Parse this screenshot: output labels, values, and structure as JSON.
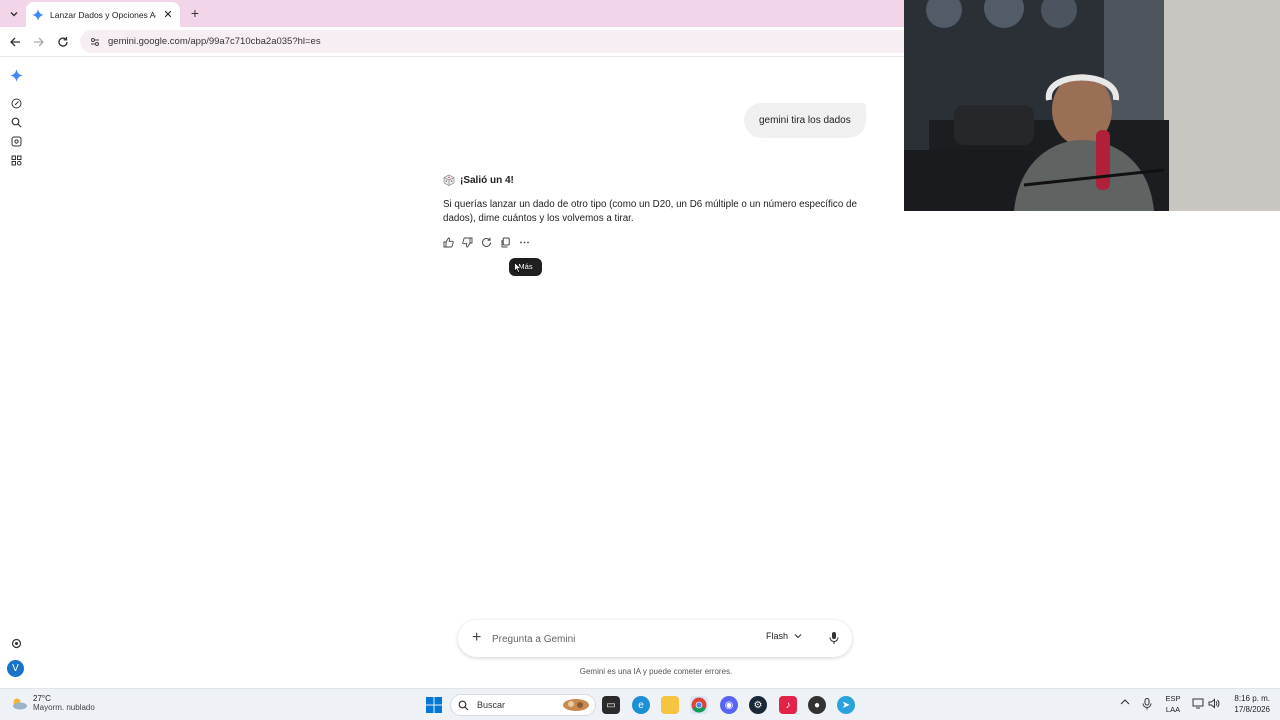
{
  "browser": {
    "tab_title": "Lanzar Dados y Opciones Adici",
    "url": "gemini.google.com/app/99a7c710cba2a035?hl=es"
  },
  "chat": {
    "user_message": "gemini tira los dados",
    "response_title": "¡Salió un 4!",
    "response_body": "Si querías lanzar un dado de otro tipo (como un D20, un D6 múltiple o un número específico de dados), dime cuántos y los volvemos a tirar.",
    "tooltip": "Más"
  },
  "prompt": {
    "placeholder": "Pregunta a Gemini",
    "model": "Flash",
    "disclaimer": "Gemini es una IA y puede cometer errores."
  },
  "user": {
    "avatar_letter": "V"
  },
  "taskbar": {
    "weather_temp": "27°C",
    "weather_desc": "Mayorm. nublado",
    "search_label": "Buscar",
    "lang_top": "ESP",
    "lang_bottom": "LAA",
    "time": "8:16 p. m.",
    "date": "17/8/2026"
  },
  "colors": {
    "tabstrip": "#f3d5ea",
    "gemini_blue": "#4285f4",
    "avatar": "#1a73c8"
  }
}
